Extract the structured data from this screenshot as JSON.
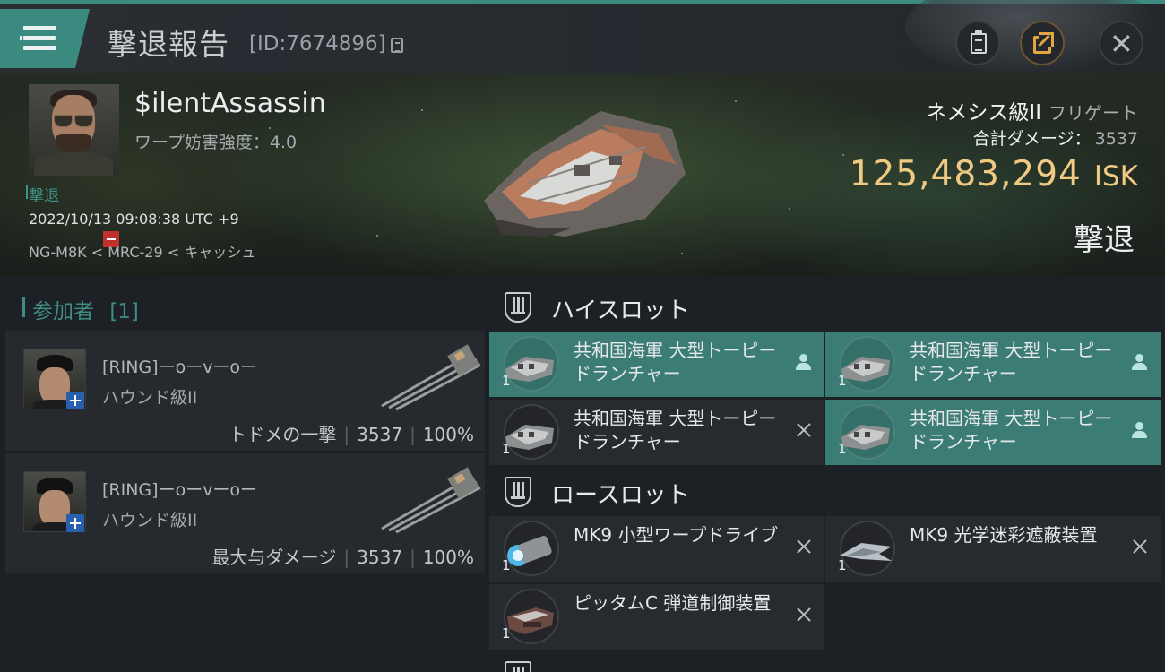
{
  "header": {
    "title": "撃退報告",
    "report_id": "[ID:7674896]"
  },
  "victim": {
    "name": "$ilentAssassin",
    "warp_label": "ワープ妨害強度：4.0",
    "role": "撃退",
    "timestamp": "2022/10/13 09:08:38 UTC +9",
    "location": "NG-M8K < MRC-29 < キャッシュ",
    "ship_name": "ネメシス級II",
    "ship_class": "フリゲート",
    "damage_label": "合計ダメージ：",
    "damage_value": "3537",
    "isk_value": "125,483,294",
    "isk_unit": "ISK",
    "result": "撃退"
  },
  "participants": {
    "title": "参加者",
    "count": "[1]",
    "rows": [
      {
        "name": "[RING]ーoーvーoー",
        "ship": "ハウンド級II",
        "label": "トドメの一撃",
        "damage": "3537",
        "percent": "100%"
      },
      {
        "name": "[RING]ーoーvーoー",
        "ship": "ハウンド級II",
        "label": "最大与ダメージ",
        "damage": "3537",
        "percent": "100%"
      }
    ]
  },
  "slots": {
    "high": {
      "title": "ハイスロット",
      "modules": [
        {
          "name": "共和国海軍 大型トーピードランチャー",
          "qty": "1",
          "state": "person-icon"
        },
        {
          "name": "共和国海軍 大型トーピードランチャー",
          "qty": "1",
          "state": "person-icon"
        },
        {
          "name": "共和国海軍 大型トーピードランチャー",
          "qty": "1",
          "state": "close-icon"
        },
        {
          "name": "共和国海軍 大型トーピードランチャー",
          "qty": "1",
          "state": "person-icon"
        }
      ]
    },
    "low": {
      "title": "ロースロット",
      "modules": [
        {
          "name": "MK9 小型ワープドライブ",
          "qty": "1",
          "state": "close-icon"
        },
        {
          "name": "MK9 光学迷彩遮蔽装置",
          "qty": "1",
          "state": "close-icon"
        },
        {
          "name": "ピッタムC 弾道制御装置",
          "qty": "1",
          "state": "close-icon"
        }
      ]
    }
  },
  "colors": {
    "accent_teal": "#3b8a80",
    "isk_gold": "#f0c983",
    "dropped_module": "#3b7d74"
  }
}
